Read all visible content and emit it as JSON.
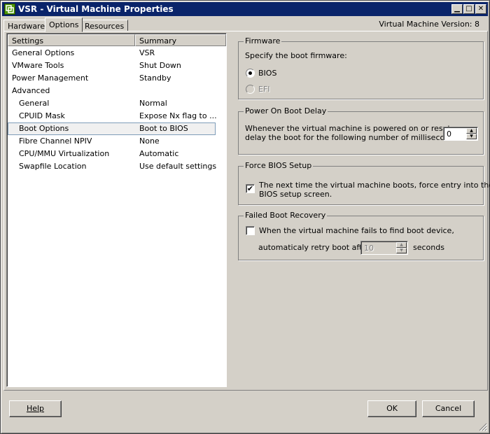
{
  "window": {
    "title": "VSR - Virtual Machine Properties",
    "version_label": "Virtual Machine Version: 8"
  },
  "tabs": [
    {
      "label": "Hardware"
    },
    {
      "label": "Options"
    },
    {
      "label": "Resources"
    }
  ],
  "settings": {
    "headers": {
      "settings": "Settings",
      "summary": "Summary"
    },
    "rows": [
      {
        "setting": "General Options",
        "summary": "VSR"
      },
      {
        "setting": "VMware Tools",
        "summary": "Shut Down"
      },
      {
        "setting": "Power Management",
        "summary": "Standby"
      },
      {
        "setting": "Advanced",
        "summary": ""
      },
      {
        "setting": "General",
        "summary": "Normal"
      },
      {
        "setting": "CPUID Mask",
        "summary": "Expose Nx flag to ..."
      },
      {
        "setting": "Boot Options",
        "summary": "Boot to BIOS"
      },
      {
        "setting": "Fibre Channel NPIV",
        "summary": "None"
      },
      {
        "setting": "CPU/MMU Virtualization",
        "summary": "Automatic"
      },
      {
        "setting": "Swapfile Location",
        "summary": "Use default settings"
      }
    ]
  },
  "firmware": {
    "title": "Firmware",
    "prompt": "Specify the boot firmware:",
    "bios_label": "BIOS",
    "efi_label": "EFI",
    "selected": "BIOS"
  },
  "boot_delay": {
    "title": "Power On Boot Delay",
    "line1": "Whenever the virtual machine is powered on or reset,",
    "line2": "delay the boot for the following number of milliseconds:",
    "value": "0"
  },
  "force_bios": {
    "title": "Force BIOS Setup",
    "line1": "The next time the virtual machine boots, force entry into the",
    "line2": "BIOS setup screen.",
    "checked": true
  },
  "failed_boot": {
    "title": "Failed Boot Recovery",
    "line1": "When the virtual machine fails to find boot device,",
    "line2": "automaticaly retry boot after",
    "value": "10",
    "unit": "seconds",
    "checked": false
  },
  "buttons": {
    "help": "Help",
    "ok": "OK",
    "cancel": "Cancel"
  }
}
